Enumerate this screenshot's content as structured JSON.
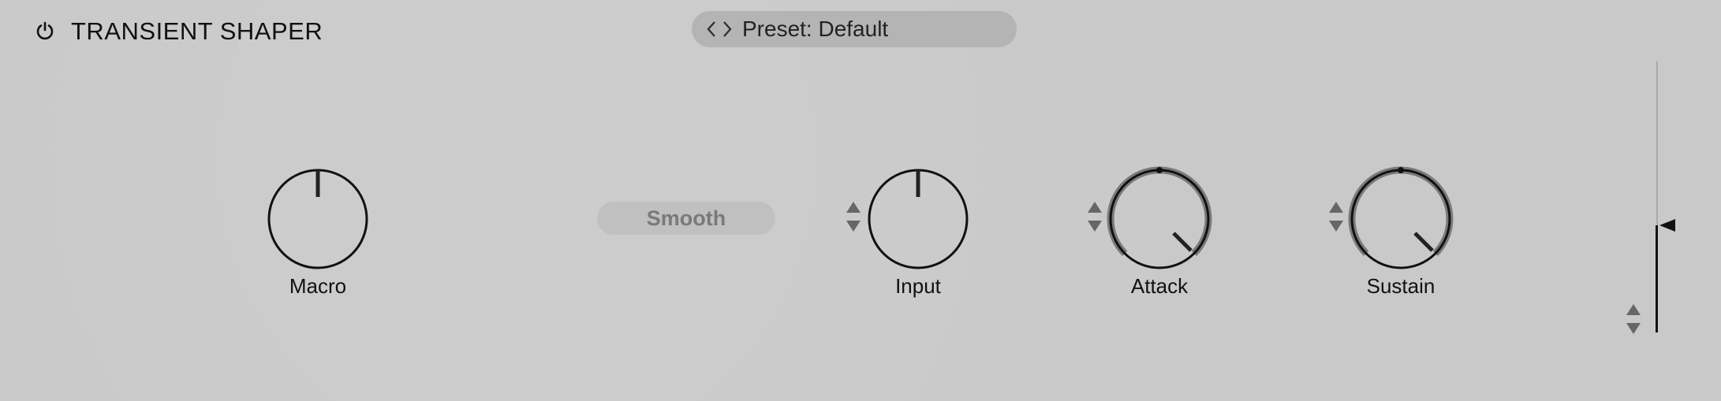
{
  "header": {
    "title": "TRANSIENT SHAPER",
    "power_icon": "power-icon",
    "preset_label": "Preset: Default",
    "preset_nav_icons": [
      "chevron-left-icon",
      "chevron-right-icon"
    ]
  },
  "controls": {
    "smooth_label": "Smooth",
    "knobs": [
      {
        "name": "macro",
        "label": "Macro"
      },
      {
        "name": "input",
        "label": "Input"
      },
      {
        "name": "attack",
        "label": "Attack"
      },
      {
        "name": "sustain",
        "label": "Sustain"
      }
    ]
  },
  "colors": {
    "background": "#c9c9c9",
    "preset_pill": "#b4b4b4",
    "knob_stroke": "#111111",
    "knob_arc": "#7a7a7a",
    "smooth_text": "#7a7a7a"
  }
}
